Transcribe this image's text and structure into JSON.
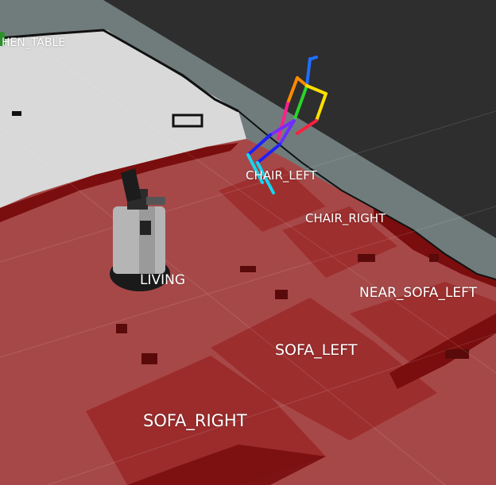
{
  "scene": {
    "colors": {
      "background": "#6f7c7b",
      "dark_area": "#2e2e2e",
      "free_space": "#d9d9d9",
      "region_overlay": "#b03030",
      "region_dark": "#7a0d0d",
      "obstacle": "#000000",
      "skeleton_head": "#1f6fff",
      "skeleton_spine": "#2bd42b",
      "skeleton_arm_left": "#ff8a00",
      "skeleton_arm_right": "#ffe000",
      "skeleton_leg_left": "#ff1f8f",
      "skeleton_leg_right": "#1f1fff",
      "skeleton_foot": "#16d6f0"
    },
    "icons": {
      "robot": "service-robot-model",
      "person": "human-skeleton-marker",
      "kitchen_marker": "location-marker"
    }
  },
  "labels": {
    "kitchen_table": "HEN_TABLE",
    "chair_left": "CHAIR_LEFT",
    "chair_right": "CHAIR_RIGHT",
    "living": "LIVING",
    "near_sofa_left": "NEAR_SOFA_LEFT",
    "sofa_left": "SOFA_LEFT",
    "sofa_right": "SOFA_RIGHT"
  }
}
